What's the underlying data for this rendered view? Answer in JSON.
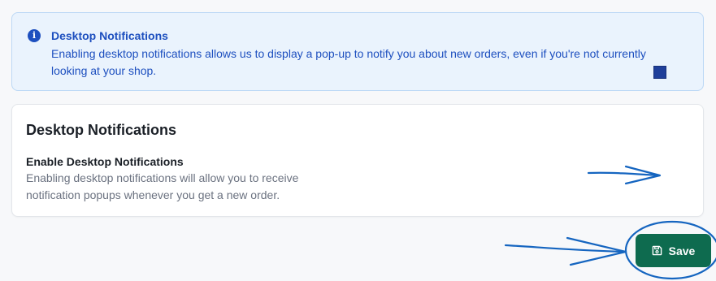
{
  "banner": {
    "icon": "info-icon",
    "title": "Desktop Notifications",
    "text": "Enabling desktop notifications allows us to display a pop-up to notify you about new orders, even if you're not currently looking at your shop."
  },
  "card": {
    "title": "Desktop Notifications",
    "setting": {
      "label": "Enable Desktop Notifications",
      "description": "Enabling desktop notifications will allow you to receive notification popups whenever you get a new order.",
      "checkbox_color": "#1f3f9a"
    }
  },
  "footer": {
    "save_label": "Save",
    "save_icon": "floppy-disk-icon",
    "save_color": "#0e6b4f"
  },
  "annotations": {
    "color": "#1565c0",
    "marks": [
      "arrow-to-checkbox",
      "arrow-to-save-button",
      "circle-around-save-button"
    ]
  }
}
